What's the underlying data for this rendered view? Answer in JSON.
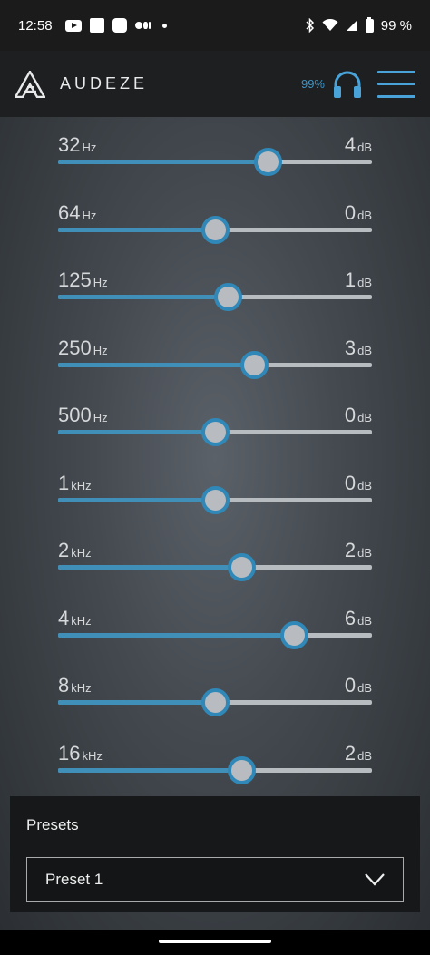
{
  "status_bar": {
    "time": "12:58",
    "battery": "99 %"
  },
  "header": {
    "brand": "AUDEZE",
    "battery_pct": "99%",
    "accent_color": "#3e93c4"
  },
  "eq": {
    "gain_range_db": [
      -12,
      12
    ],
    "bands": [
      {
        "freq": "32",
        "freq_unit": "Hz",
        "gain": "4",
        "gain_unit": "dB",
        "gain_value": 4
      },
      {
        "freq": "64",
        "freq_unit": "Hz",
        "gain": "0",
        "gain_unit": "dB",
        "gain_value": 0
      },
      {
        "freq": "125",
        "freq_unit": "Hz",
        "gain": "1",
        "gain_unit": "dB",
        "gain_value": 1
      },
      {
        "freq": "250",
        "freq_unit": "Hz",
        "gain": "3",
        "gain_unit": "dB",
        "gain_value": 3
      },
      {
        "freq": "500",
        "freq_unit": "Hz",
        "gain": "0",
        "gain_unit": "dB",
        "gain_value": 0
      },
      {
        "freq": "1",
        "freq_unit": "kHz",
        "gain": "0",
        "gain_unit": "dB",
        "gain_value": 0
      },
      {
        "freq": "2",
        "freq_unit": "kHz",
        "gain": "2",
        "gain_unit": "dB",
        "gain_value": 2
      },
      {
        "freq": "4",
        "freq_unit": "kHz",
        "gain": "6",
        "gain_unit": "dB",
        "gain_value": 6
      },
      {
        "freq": "8",
        "freq_unit": "kHz",
        "gain": "0",
        "gain_unit": "dB",
        "gain_value": 0
      },
      {
        "freq": "16",
        "freq_unit": "kHz",
        "gain": "2",
        "gain_unit": "dB",
        "gain_value": 2
      }
    ]
  },
  "presets": {
    "title": "Presets",
    "selected": "Preset 1"
  }
}
